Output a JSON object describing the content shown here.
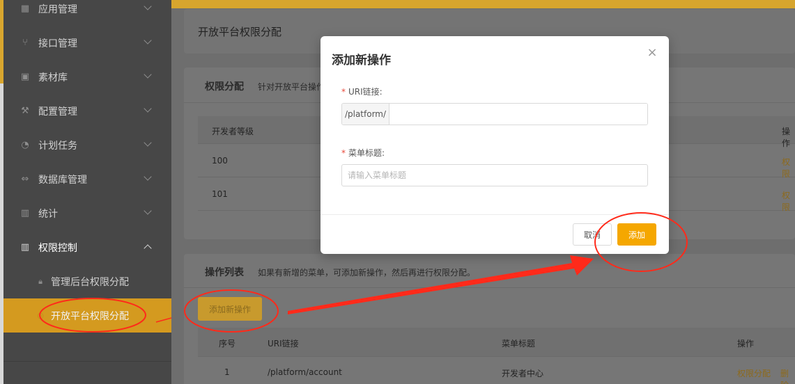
{
  "sidebar": {
    "items": [
      {
        "label": "应用管理",
        "icon": "grid-icon"
      },
      {
        "label": "接口管理",
        "icon": "branch-icon"
      },
      {
        "label": "素材库",
        "icon": "image-icon"
      },
      {
        "label": "配置管理",
        "icon": "wrench-icon"
      },
      {
        "label": "计划任务",
        "icon": "clock-icon"
      },
      {
        "label": "数据库管理",
        "icon": "link-icon"
      },
      {
        "label": "统计",
        "icon": "bar-chart-icon"
      },
      {
        "label": "权限控制",
        "icon": "bar-chart-icon"
      }
    ],
    "sub_items": [
      {
        "label": "管理后台权限分配",
        "icon": "lock-icon"
      },
      {
        "label": "开放平台权限分配",
        "icon": "circle-icon"
      }
    ]
  },
  "page": {
    "title": "开放平台权限分配"
  },
  "permission_card": {
    "title": "权限分配",
    "desc": "针对开放平台操作",
    "columns": [
      "开发者等级",
      "操作"
    ],
    "rows": [
      {
        "level": "100",
        "action": "权限"
      },
      {
        "level": "101",
        "action": "权限"
      }
    ]
  },
  "ops_card": {
    "title": "操作列表",
    "desc": "如果有新增的菜单，可添加新操作，然后再进行权限分配。",
    "add_button": "添加新操作",
    "columns": [
      "序号",
      "URI链接",
      "菜单标题",
      "操作"
    ],
    "rows": [
      {
        "no": "1",
        "uri": "/platform/account",
        "title": "开发者中心",
        "action1": "权限分配",
        "action2": "删除"
      }
    ]
  },
  "modal": {
    "title": "添加新操作",
    "close": "×",
    "uri_label": "URI链接:",
    "uri_prefix": "/platform/",
    "uri_value": "",
    "menu_label": "菜单标题:",
    "menu_placeholder": "请输入菜单标题",
    "required_mark": "*",
    "cancel": "取消",
    "confirm": "添加"
  },
  "colors": {
    "accent": "#f5a700",
    "annotation": "#ff2a1a",
    "sidebar_bg": "#474747"
  }
}
